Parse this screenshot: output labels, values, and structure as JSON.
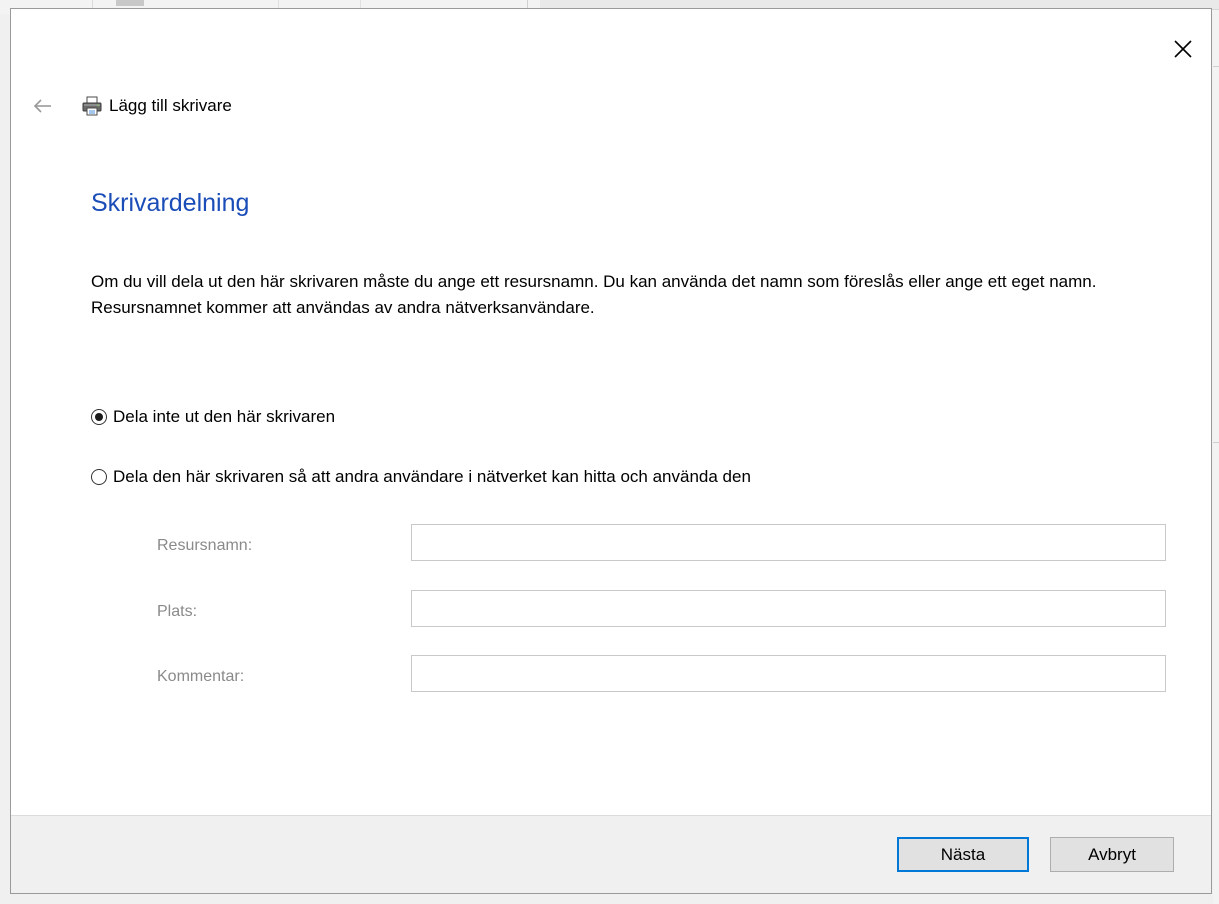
{
  "window": {
    "title": "Lägg till skrivare",
    "close_icon": "close-icon",
    "back_icon": "back-arrow-icon",
    "app_icon": "printer-icon"
  },
  "page": {
    "heading": "Skrivardelning",
    "description": "Om du vill dela ut den här skrivaren måste du ange ett resursnamn. Du kan använda det namn som föreslås eller ange ett eget namn. Resursnamnet kommer att användas av andra nätverksanvändare."
  },
  "sharing_options": [
    {
      "label": "Dela inte ut den här skrivaren",
      "selected": true
    },
    {
      "label": "Dela den här skrivaren så att andra användare i nätverket kan hitta och använda den",
      "selected": false
    }
  ],
  "fields": {
    "share_name": {
      "label": "Resursnamn:",
      "value": "",
      "disabled": true
    },
    "location": {
      "label": "Plats:",
      "value": "",
      "disabled": true
    },
    "comment": {
      "label": "Kommentar:",
      "value": "",
      "disabled": true
    }
  },
  "buttons": {
    "next_label": "Nästa",
    "cancel_label": "Avbryt"
  },
  "colors": {
    "heading": "#1a4db8",
    "default_button_border": "#0078d7",
    "disabled_label": "#8a8a8a"
  }
}
